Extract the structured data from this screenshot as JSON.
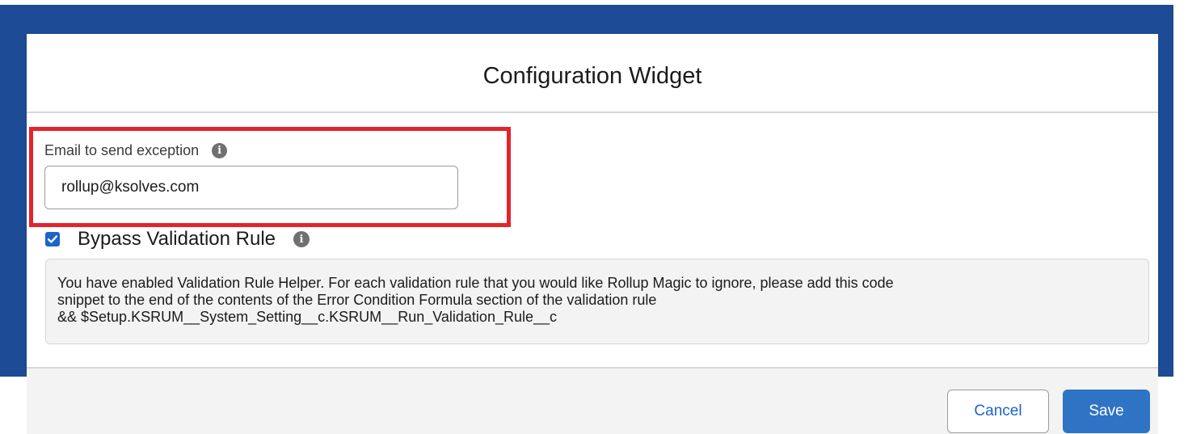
{
  "modal": {
    "title": "Configuration Widget"
  },
  "email_field": {
    "label": "Email to send exception",
    "value": "rollup@ksolves.com"
  },
  "bypass": {
    "label": "Bypass Validation Rule",
    "checked": true
  },
  "info_box": {
    "line1": "You have enabled Validation Rule Helper. For each validation rule that you would like Rollup Magic to ignore, please add this code",
    "line2": "snippet to the end of the contents of the Error Condition Formula section of the validation rule",
    "line3": "&& $Setup.KSRUM__System_Setting__c.KSRUM__Run_Validation_Rule__c"
  },
  "footer": {
    "cancel_label": "Cancel",
    "save_label": "Save"
  },
  "colors": {
    "backdrop": "#1c4a94",
    "highlight": "#e2242d",
    "brand_blue": "#1b64c9",
    "save_button": "#2f74c4"
  }
}
